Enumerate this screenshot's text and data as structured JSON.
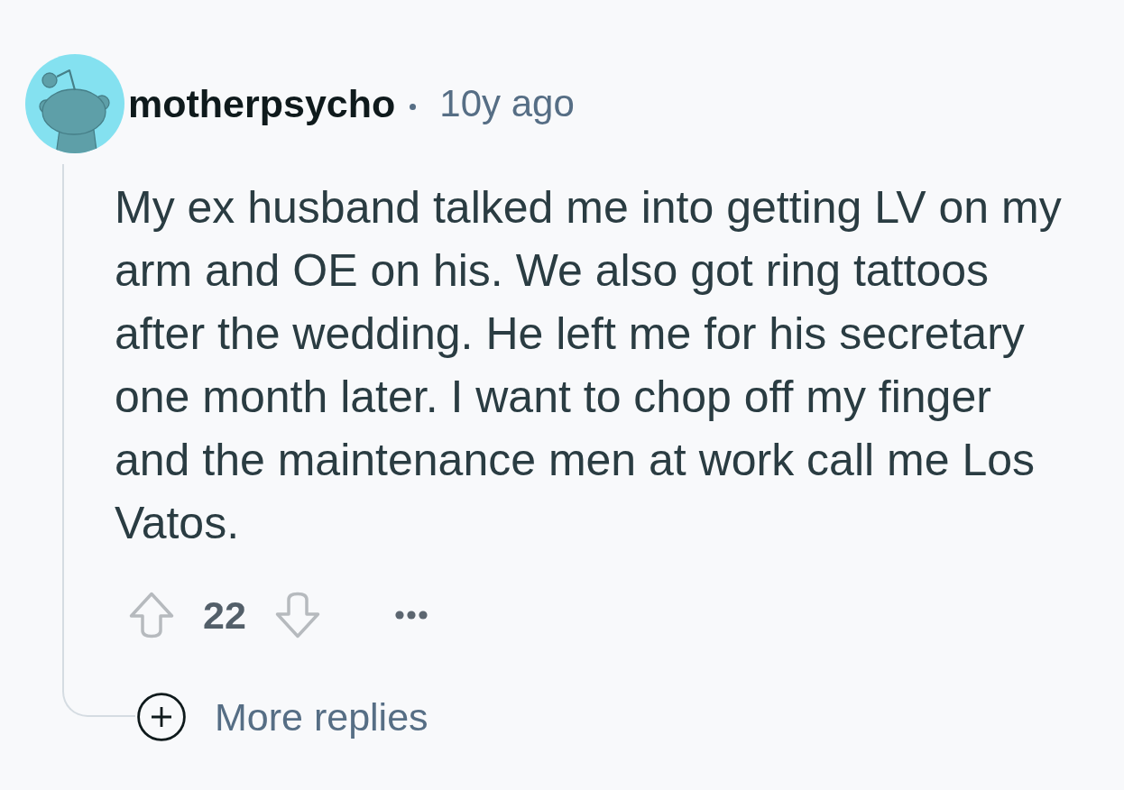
{
  "comment": {
    "author": "motherpsycho",
    "time": "10y ago",
    "body": "My ex husband talked me into getting LV on my arm and OE on his. We also got ring tattoos after the wedding. He left me for his secretary one month later. I want to chop off my finger and the maintenance men at work call me Los Vatos.",
    "score": "22"
  },
  "more_replies": {
    "label": "More replies"
  }
}
